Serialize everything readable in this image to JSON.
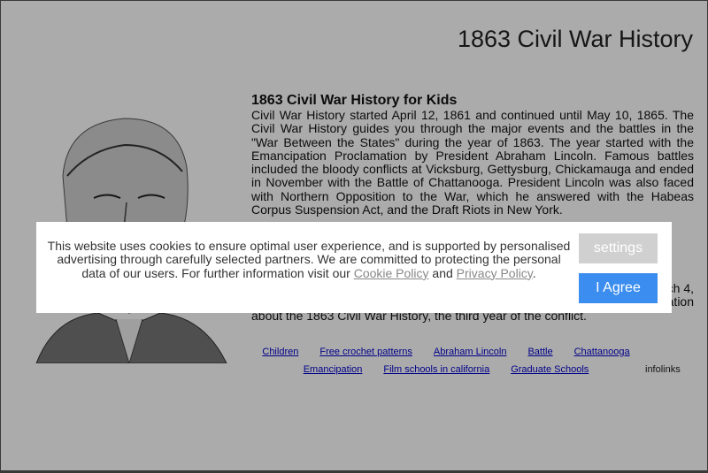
{
  "site": {
    "title": "1863 Civil War History"
  },
  "article": {
    "heading": "1863 Civil War History for Kids",
    "paragraph1": "Civil War History started April 12, 1861 and continued until May 10, 1865. The Civil War History guides you through the major events and the battles in the \"War Between the States\" during the year of 1863. The year started with the Emancipation Proclamation by President Abraham Lincoln. Famous battles included the bloody conflicts at Vicksburg, Gettysburg, Chickamauga and ended in November with the Battle of Chattanooga. President Lincoln was also faced with Northern Opposition to the War, which he answered with the Habeas Corpus Suspension Act, and the Draft Riots in New York.",
    "paragraph2_line1_end": "ch 4,",
    "paragraph2_line2_end": "ation",
    "paragraph2_line3": "about the 1863 Civil War History, the third year of the conflict."
  },
  "ad_links": {
    "row1": [
      "Children",
      "Free crochet patterns",
      "Abraham Lincoln",
      "Battle",
      "Chattanooga"
    ],
    "row2": [
      "Emancipation",
      "Film schools in california",
      "Graduate Schools"
    ],
    "brand": "infolinks"
  },
  "cookie_banner": {
    "text_before": "This website uses cookies to ensure optimal user experience, and is supported by personalised advertising through carefully selected partners. We are committed to protecting the personal data of our users. For further information visit our",
    "cookie_policy": "Cookie Policy",
    "and": "and",
    "privacy_policy": "Privacy Policy",
    "period": ".",
    "settings_label": "settings",
    "agree_label": "I Agree"
  },
  "colors": {
    "agree_button": "#3b8def",
    "settings_button": "#d0d0d0",
    "link": "#0000cc"
  }
}
